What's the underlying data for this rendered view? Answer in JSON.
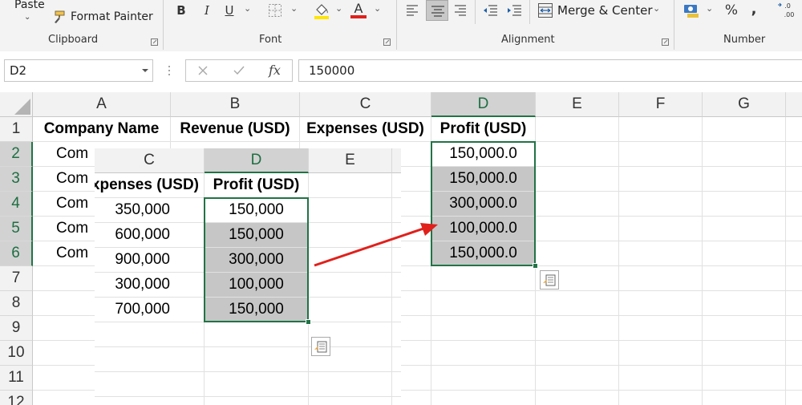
{
  "ribbon": {
    "clipboard": {
      "paste_label": "Paste",
      "format_painter_label": "Format Painter",
      "group_label": "Clipboard"
    },
    "font": {
      "bold_label": "B",
      "italic_label": "I",
      "underline_label": "U",
      "group_label": "Font"
    },
    "alignment": {
      "merge_center_label": "Merge & Center",
      "group_label": "Alignment"
    },
    "number": {
      "percent_label": "%",
      "comma_label": ",",
      "group_label": "Number"
    }
  },
  "formula_bar": {
    "name_box": "D2",
    "formula_value": "150000"
  },
  "main_sheet": {
    "columns": [
      "A",
      "B",
      "C",
      "D",
      "E",
      "F",
      "G"
    ],
    "rows": [
      "1",
      "2",
      "3",
      "4",
      "5",
      "6",
      "7",
      "8",
      "9",
      "10",
      "11",
      "12"
    ],
    "headers": [
      "Company Name",
      "Revenue (USD)",
      "Expenses (USD)",
      "Profit (USD)"
    ],
    "company_truncated": [
      "Com",
      "Com",
      "Com",
      "Com",
      "Com"
    ],
    "profit_values": [
      "150,000.0",
      "150,000.0",
      "300,000.0",
      "100,000.0",
      "150,000.0"
    ]
  },
  "inset_sheet": {
    "columns": [
      "C",
      "D",
      "E"
    ],
    "headers": [
      "Expenses (USD)",
      "Profit (USD)"
    ],
    "expenses": [
      "350,000",
      "600,000",
      "900,000",
      "300,000",
      "700,000"
    ],
    "profit": [
      "150,000",
      "150,000",
      "300,000",
      "100,000",
      "150,000"
    ]
  },
  "colors": {
    "excel_green": "#217346",
    "arrow_red": "#e0201b",
    "selection_gray": "#c6c6c6",
    "fill_yellow": "#ffe500",
    "font_red": "#e0201b"
  }
}
